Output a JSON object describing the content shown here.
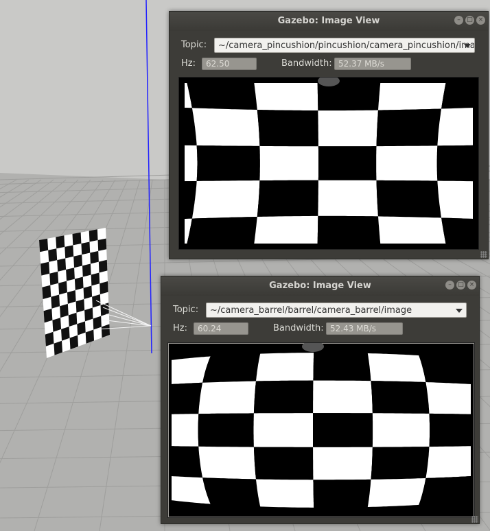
{
  "windows": [
    {
      "id": "pincushion",
      "title": "Gazebo: Image View",
      "topic_label": "Topic:",
      "topic_value": "~/camera_pincushion/pincushion/camera_pincushion/imag",
      "hz_label": "Hz:",
      "hz_value": "62.50",
      "bandwidth_label": "Bandwidth:",
      "bandwidth_value": "52.37 MB/s",
      "distortion": "pincushion"
    },
    {
      "id": "barrel",
      "title": "Gazebo: Image View",
      "topic_label": "Topic:",
      "topic_value": "~/camera_barrel/barrel/camera_barrel/image",
      "hz_label": "Hz:",
      "hz_value": "60.24",
      "bandwidth_label": "Bandwidth:",
      "bandwidth_value": "52.43 MB/s",
      "distortion": "barrel"
    }
  ],
  "window_controls": [
    "minimize-icon",
    "maximize-icon",
    "close-icon"
  ],
  "colors": {
    "scene_background": "#c9c9c7",
    "ground": "#b2b2b0",
    "window_bg": "#3d3c38",
    "axis_z": "#2020ff",
    "axis_x": "#e02020",
    "axis_y": "#20c020"
  }
}
